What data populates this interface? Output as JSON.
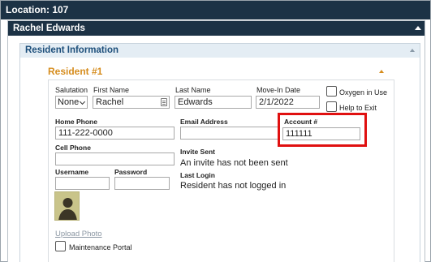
{
  "location_bar": {
    "text": "Location: 107"
  },
  "panel": {
    "title": "Rachel Edwards"
  },
  "section": {
    "title": "Resident Information"
  },
  "resident": {
    "title": "Resident #1",
    "salutation": {
      "label": "Salutation",
      "value": "None"
    },
    "first_name": {
      "label": "First Name",
      "value": "Rachel"
    },
    "last_name": {
      "label": "Last Name",
      "value": "Edwards"
    },
    "move_in": {
      "label": "Move-In Date",
      "value": "2/1/2022"
    },
    "oxygen": {
      "label": "Oxygen in Use"
    },
    "help_to_exit": {
      "label": "Help to Exit"
    },
    "home_phone": {
      "label": "Home Phone",
      "value": "111-222-0000"
    },
    "email": {
      "label": "Email Address",
      "value": ""
    },
    "account": {
      "label": "Account #",
      "value": "111111"
    },
    "cell_phone": {
      "label": "Cell Phone",
      "value": ""
    },
    "invite_sent": {
      "label": "Invite Sent",
      "value": "An invite has not been sent"
    },
    "username": {
      "label": "Username",
      "value": ""
    },
    "password": {
      "label": "Password",
      "value": ""
    },
    "last_login": {
      "label": "Last Login",
      "value": "Resident has not logged in"
    },
    "upload_photo": "Upload Photo",
    "maintenance_portal": "Maintenance Portal"
  },
  "colors": {
    "header_bg": "#1c3245",
    "section_head_bg": "#e4edf4",
    "resident_title": "#d68d1e",
    "highlight": "#e01010"
  }
}
